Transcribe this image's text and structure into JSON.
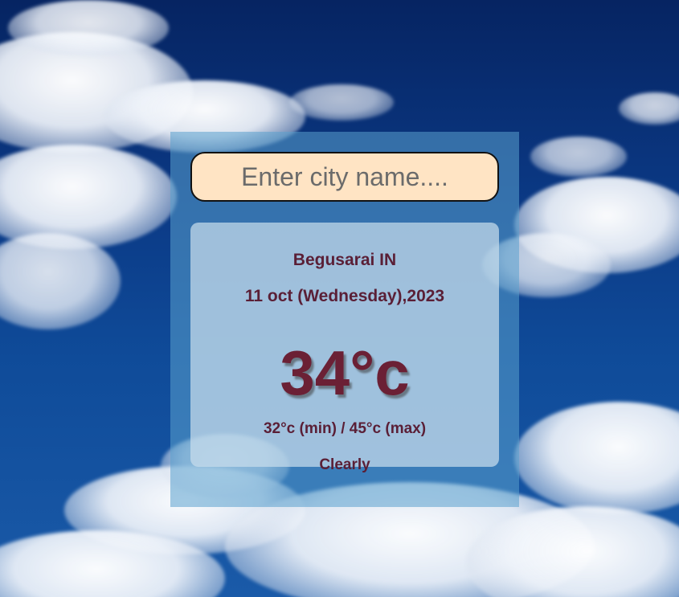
{
  "search": {
    "placeholder": "Enter city name...."
  },
  "weather": {
    "location": "Begusarai IN",
    "date": "11 oct (Wednesday),2023",
    "temperature": "34°c",
    "min_max": "32°c (min) / 45°c (max)",
    "condition": "Clearly"
  },
  "colors": {
    "text": "#5a1f36",
    "search_bg": "#ffe4c4"
  }
}
